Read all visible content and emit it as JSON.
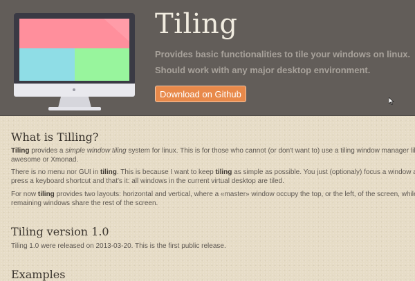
{
  "header": {
    "title": "Tiling",
    "tagline1": "Provides basic functionalities to tile your windows on linux.",
    "tagline2": "Should work with any major desktop environment.",
    "download_label": "Download on Github",
    "monitor_icon": "desktop-monitor-tiling-icon",
    "colors": {
      "header_bg": "#625d59",
      "tile_pink": "#ff8f9c",
      "tile_cyan": "#8fdde6",
      "tile_green": "#98f59d",
      "button": "#e8894a"
    }
  },
  "sections": {
    "what": {
      "heading": "What is Tilling?",
      "p1": {
        "b1": "Tiling",
        "t1": " provides a ",
        "em1": "simple window tiling",
        "t2": " system for linux. This is for those who cannot (or don't want to) use a tiling window manager lik",
        "t3": "awesome or Xmonad."
      },
      "p2": {
        "t1": "There is no menu nor GUI in ",
        "b1": "tiling",
        "t2": ". This is because I want to keep ",
        "b2": "tiling",
        "t3": " as simple as possible. You just (optionaly) focus a window a",
        "t4": "press a keyboard shortcut and that's it: all windows in the current virtual desktop are tiled."
      },
      "p3": {
        "t1": "For now ",
        "b1": "tiling",
        "t2": " provides two layouts: horizontal and vertical, where a «master» window occupy the top, or the left, of the screen, while",
        "t3": "remaining windows share the rest of the screen."
      }
    },
    "version": {
      "heading": "Tiling version 1.0",
      "p1": "Tiling 1.0 were released on 2013-03-20. This is the first public release."
    },
    "examples": {
      "heading": "Examples"
    }
  }
}
